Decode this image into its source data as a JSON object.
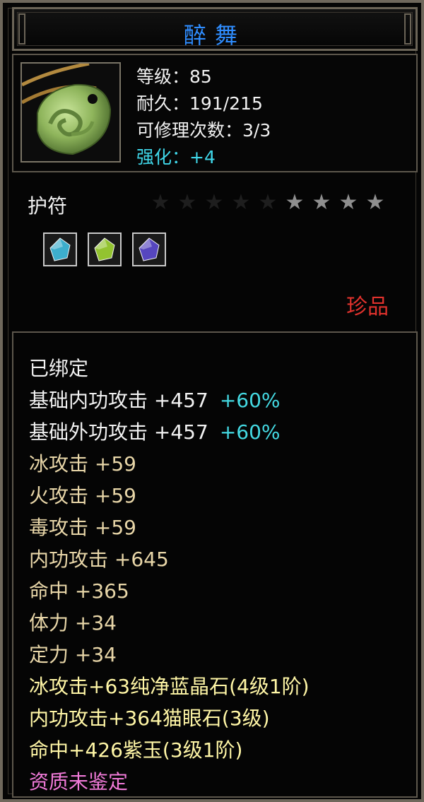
{
  "item": {
    "name": "醉舞",
    "level": "等级：85",
    "durability": "耐久：191/215",
    "repairs": "可修理次数：3/3",
    "enhance": "强化：+4",
    "type": "护符",
    "rarity": "珍品",
    "stars": {
      "filled": 4,
      "total": 9
    },
    "gems": [
      {
        "name": "blue-crystal-gem-icon",
        "color": "#3fb6d6"
      },
      {
        "name": "green-cat-eye-gem-icon",
        "color": "#9acd32"
      },
      {
        "name": "purple-jade-gem-icon",
        "color": "#5a49c8"
      }
    ]
  },
  "attributes": [
    {
      "text": "已绑定",
      "extra": ""
    },
    {
      "text": "基础内功攻击 +457",
      "extra": "+60%"
    },
    {
      "text": "基础外功攻击 +457",
      "extra": "+60%"
    },
    {
      "text": "冰攻击 +59",
      "extra": ""
    },
    {
      "text": "火攻击 +59",
      "extra": ""
    },
    {
      "text": "毒攻击 +59",
      "extra": ""
    },
    {
      "text": "内功攻击 +645",
      "extra": ""
    },
    {
      "text": "命中 +365",
      "extra": ""
    },
    {
      "text": "体力 +34",
      "extra": ""
    },
    {
      "text": "定力 +34",
      "extra": ""
    },
    {
      "text": "冰攻击+63纯净蓝晶石(4级1阶)",
      "extra": ""
    },
    {
      "text": "内功攻击+364猫眼石(3级)",
      "extra": ""
    },
    {
      "text": "命中+426紫玉(3级1阶)",
      "extra": ""
    },
    {
      "text": "资质未鉴定",
      "extra": ""
    }
  ],
  "colors": {
    "title": "#2f8dff",
    "stat": "#f1f1f1",
    "enhance": "#3fd6e8",
    "attr_gold": "#e8d6a8",
    "percent": "#44d9e2",
    "gem_line": "#fff6a6",
    "unidentified": "#f07ad8",
    "rare": "#e0322d"
  }
}
